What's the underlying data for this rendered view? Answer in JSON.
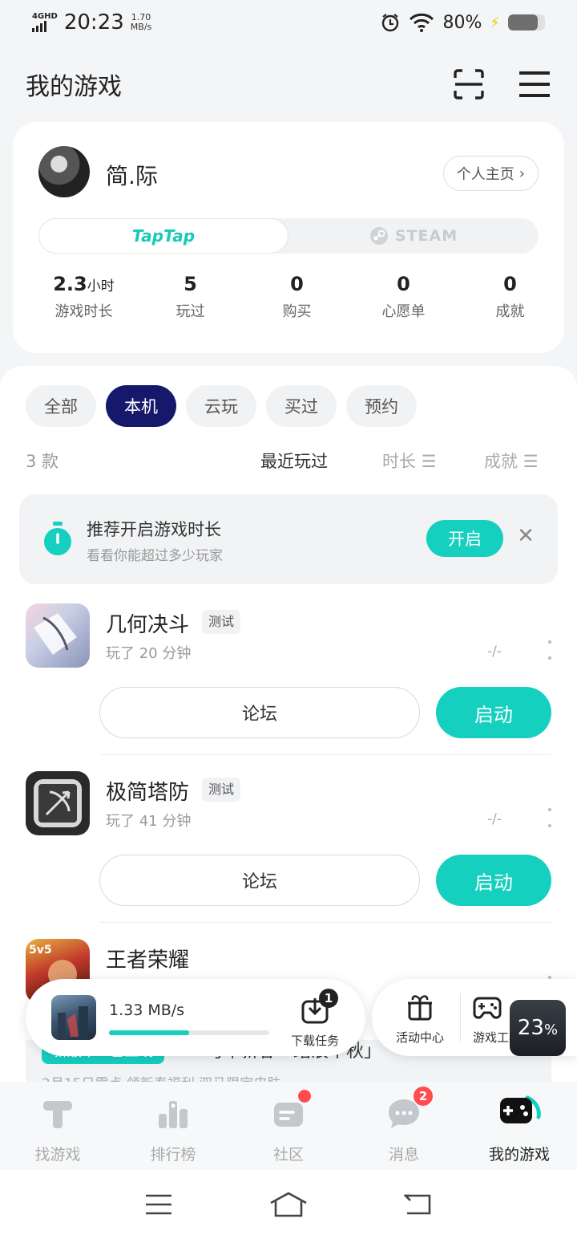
{
  "status_bar": {
    "network": "4GHD",
    "time": "20:23",
    "speed_value": "1.70",
    "speed_unit": "MB/s",
    "battery": "80%",
    "battery_level": 0.8
  },
  "header": {
    "title": "我的游戏",
    "icons": [
      "scan-icon",
      "menu-icon"
    ]
  },
  "profile": {
    "username": "简.际",
    "home_button": "个人主页",
    "platforms": {
      "taptap": "TapTap",
      "steam": "STEAM"
    },
    "stats": [
      {
        "value": "2.3",
        "unit": "小时",
        "label": "游戏时长"
      },
      {
        "value": "5",
        "unit": "",
        "label": "玩过"
      },
      {
        "value": "0",
        "unit": "",
        "label": "购买"
      },
      {
        "value": "0",
        "unit": "",
        "label": "心愿单"
      },
      {
        "value": "0",
        "unit": "",
        "label": "成就"
      }
    ]
  },
  "filters": [
    "全部",
    "本机",
    "云玩",
    "买过",
    "预约"
  ],
  "active_filter": "本机",
  "sort": {
    "count": "3 款",
    "recent": "最近玩过",
    "duration": "时长",
    "achievement": "成就"
  },
  "promo": {
    "title": "推荐开启游戏时长",
    "subtitle": "看看你能超过多少玩家",
    "button": "开启"
  },
  "games": [
    {
      "name": "几何决斗",
      "tag": "测试",
      "played": "玩了 20 分钟",
      "dash": "-/-",
      "forum": "论坛",
      "launch": "启动"
    },
    {
      "name": "极简塔防",
      "tag": "测试",
      "played": "玩了 41 分钟",
      "dash": "-/-",
      "forum": "论坛",
      "launch": "启动"
    },
    {
      "name": "王者荣耀",
      "tag": "",
      "played": "",
      "dash": "",
      "forum": "",
      "launch": ""
    }
  ],
  "banner": {
    "tag": "新版本 · 已上线",
    "title": "马年新春「踏浪千秋」",
    "subtitle": "2月15日零点 领新春福利 双马限定皮肤"
  },
  "download": {
    "speed": "1.33 MB/s",
    "progress": 0.5,
    "task_label": "下载任务",
    "task_count": "1"
  },
  "side_panel": {
    "activity": "活动中心",
    "tools": "游戏工具",
    "percent_value": "23",
    "percent_sign": "%"
  },
  "bottom_nav": [
    {
      "label": "找游戏",
      "icon": "find-games-icon",
      "badge": ""
    },
    {
      "label": "排行榜",
      "icon": "ranking-icon",
      "badge": ""
    },
    {
      "label": "社区",
      "icon": "community-icon",
      "badge": "dot"
    },
    {
      "label": "消息",
      "icon": "message-icon",
      "badge": "2"
    },
    {
      "label": "我的游戏",
      "icon": "my-games-icon",
      "badge": ""
    }
  ],
  "colors": {
    "accent": "#15cfbf",
    "active_chip": "#16196b",
    "badge_red": "#ff4d4f"
  }
}
